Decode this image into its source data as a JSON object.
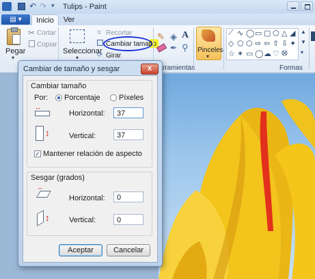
{
  "window": {
    "title": "Tulips - Paint"
  },
  "tabs": [
    {
      "label": "Inicio"
    },
    {
      "label": "Ver"
    }
  ],
  "clipboard": {
    "paste_label": "Pegar",
    "cut_label": "Cortar",
    "copy_label": "Copiar"
  },
  "image": {
    "select_label": "Seleccionar",
    "crop_label": "Recortar",
    "resize_label": "Cambiar tamaño",
    "rotate_label": "Girar"
  },
  "tools_group_label": "rramientas",
  "brushes_label": "Pinceles",
  "shapes_group_label": "Formas",
  "dialog": {
    "title": "Cambiar de tamaño y sesgar",
    "resize_section": "Cambiar tamaño",
    "by_label": "Por:",
    "percent_label": "Porcentaje",
    "pixels_label": "Píxeles",
    "horizontal_label": "Horizontal:",
    "vertical_label": "Vertical:",
    "horizontal_value": "37",
    "vertical_value": "37",
    "keep_aspect_label": "Mantener relación de aspecto",
    "skew_section": "Sesgar (grados)",
    "skew_horizontal_label": "Horizontal:",
    "skew_vertical_label": "Vertical:",
    "skew_horizontal_value": "0",
    "skew_vertical_value": "0",
    "ok_label": "Aceptar",
    "cancel_label": "Cancelar",
    "close_glyph": "x"
  },
  "colors": {
    "highlight": "#f7f32a",
    "circle": "#1a2fd6",
    "tulip": "#f5c61a",
    "stripe": "#e2301c"
  }
}
